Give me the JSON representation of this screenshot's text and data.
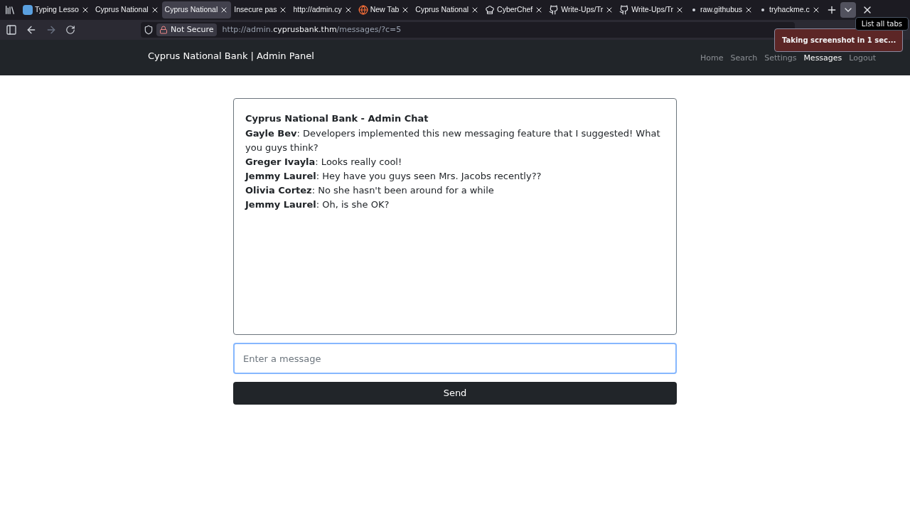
{
  "browser": {
    "tabs": [
      {
        "title": "Typing Lesso",
        "kind": "letter",
        "selected": false
      },
      {
        "title": "Cyprus National",
        "kind": "plain",
        "selected": false
      },
      {
        "title": "Cyprus National",
        "kind": "plain",
        "selected": true
      },
      {
        "title": "Insecure pas",
        "kind": "dark",
        "selected": false
      },
      {
        "title": "http://admin.cy",
        "kind": "plain",
        "selected": false
      },
      {
        "title": "New Tab",
        "kind": "browser",
        "selected": false
      },
      {
        "title": "Cyprus National",
        "kind": "plain",
        "selected": false
      },
      {
        "title": "CyberChef",
        "kind": "chef",
        "selected": false
      },
      {
        "title": "Write-Ups/Tr",
        "kind": "github",
        "selected": false
      },
      {
        "title": "Write-Ups/Tr",
        "kind": "github",
        "selected": false
      },
      {
        "title": "raw.githubus",
        "kind": "dot",
        "selected": false
      },
      {
        "title": "tryhackme.c",
        "kind": "dot",
        "selected": false
      }
    ],
    "tooltip": "List all tabs",
    "security": "Not Secure",
    "url": {
      "prefix": "http://admin.",
      "domain": "cyprusbank.thm",
      "path": "/messages/?c=5"
    },
    "notification": "Taking screenshot in 1 sec..."
  },
  "navbar": {
    "brand": "Cyprus National Bank | Admin Panel",
    "links": [
      {
        "label": "Home",
        "selected": false
      },
      {
        "label": "Search",
        "selected": false
      },
      {
        "label": "Settings",
        "selected": false
      },
      {
        "label": "Messages",
        "selected": true
      },
      {
        "label": "Logout",
        "selected": false
      }
    ]
  },
  "chat": {
    "title": "Cyprus National Bank - Admin Chat",
    "messages": [
      "**Gayle Bev**: Developers implemented this new messaging feature that I suggested! What you guys think?",
      "**Greger Ivayla**: Looks really cool!",
      "**Jemmy Laurel**: Hey have you guys seen Mrs. Jacobs recently??",
      "**Olivia Cortez**: No she hasn't been around for a while",
      "**Jemmy Laurel**: Oh, is she OK?"
    ]
  },
  "message_field": {
    "placeholder": "Enter a message"
  },
  "send_button": "Send"
}
